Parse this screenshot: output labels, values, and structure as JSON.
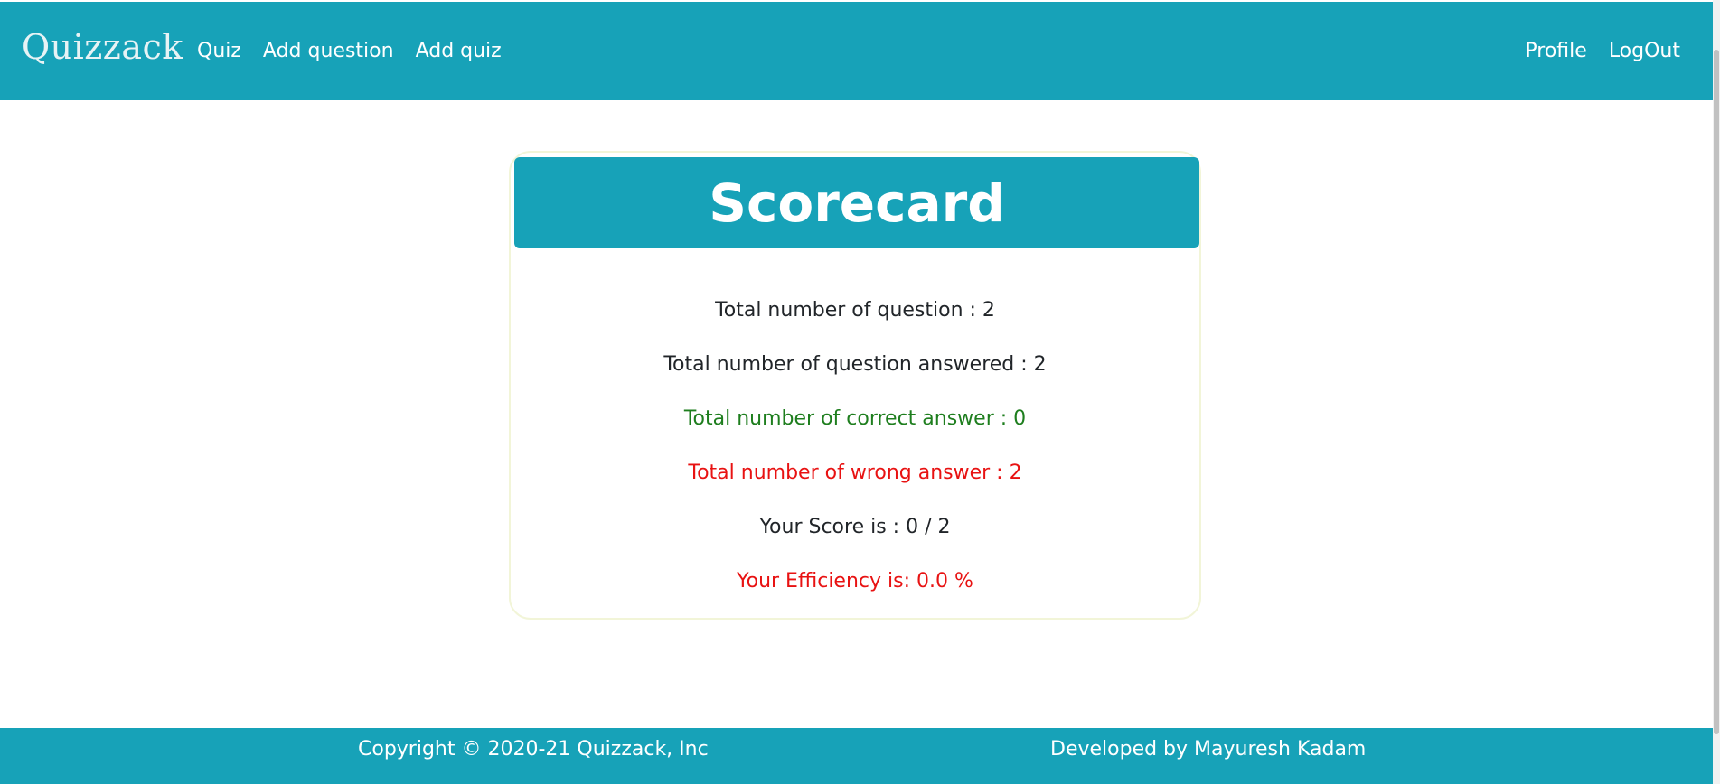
{
  "navbar": {
    "brand": "Quizzack",
    "left_links": [
      "Quiz",
      "Add question",
      "Add quiz"
    ],
    "right_links": [
      "Profile",
      "LogOut"
    ]
  },
  "scorecard": {
    "title": "Scorecard",
    "total_questions": "Total number of question : 2",
    "total_answered": "Total number of question answered : 2",
    "correct": "Total number of correct answer : 0",
    "wrong": "Total number of wrong answer : 2",
    "score": "Your Score is : 0 / 2",
    "efficiency": "Your Efficiency is: 0.0 %"
  },
  "footer": {
    "copyright": "Copyright © 2020-21 Quizzack, Inc",
    "developer": "Developed by Mayuresh Kadam"
  },
  "colors": {
    "primary": "#17a2b8",
    "correct": "#1e7e1e",
    "wrong": "#e81212",
    "text": "#212529"
  }
}
